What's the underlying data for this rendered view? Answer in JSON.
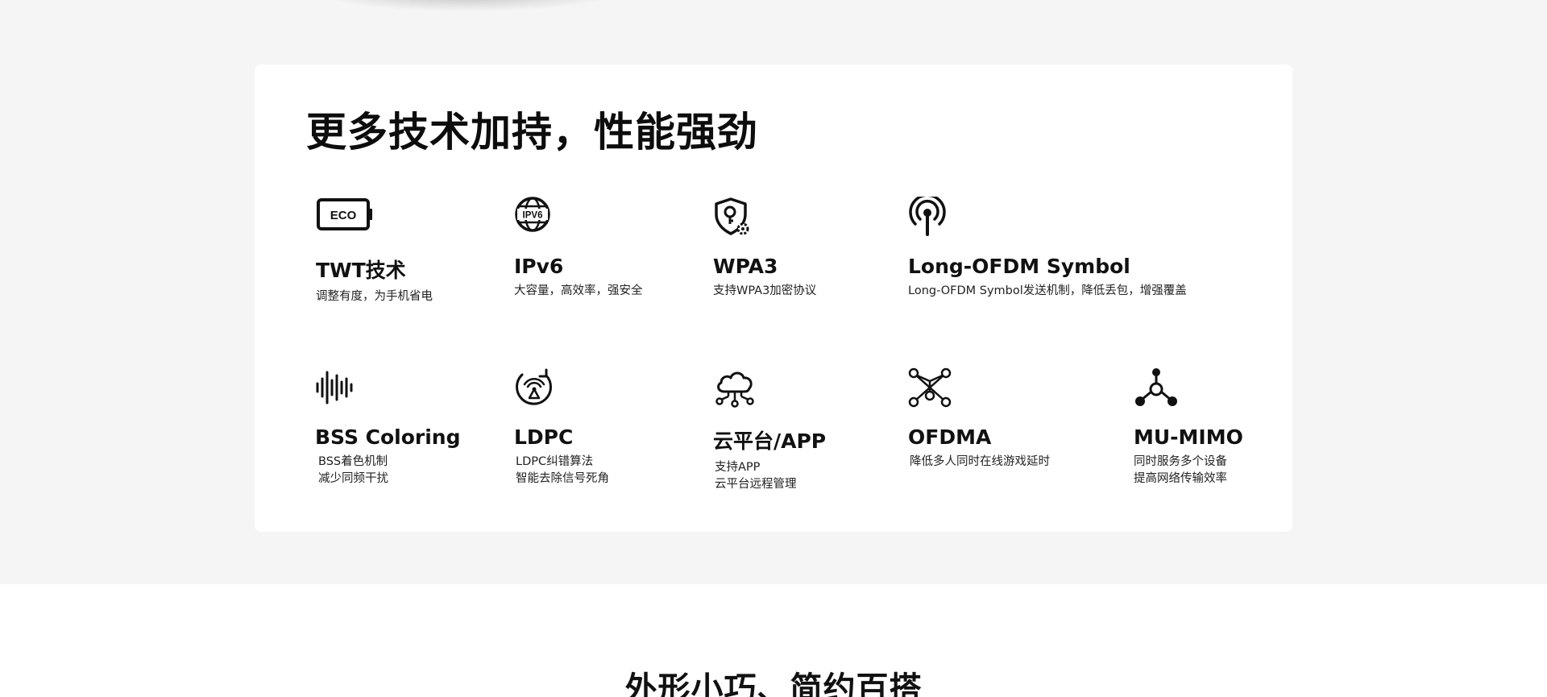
{
  "section": {
    "title": "更多技术加持，性能强劲"
  },
  "features": [
    {
      "name": "TWT技术",
      "desc": [
        "调整有度，为手机省电"
      ],
      "icon": "eco-battery-icon",
      "icon_text": "ECO"
    },
    {
      "name": "IPv6",
      "desc": [
        "大容量，高效率，强安全"
      ],
      "icon": "ipv6-globe-icon",
      "icon_text": "IPV6"
    },
    {
      "name": "WPA3",
      "desc": [
        "支持WPA3加密协议"
      ],
      "icon": "security-shield-icon"
    },
    {
      "name": "Long-OFDM Symbol",
      "desc": [
        "Long-OFDM Symbol发送机制，降低丢包，增强覆盖"
      ],
      "icon": "antenna-signal-icon"
    },
    {
      "name": "BSS Coloring",
      "desc": [
        "BSS着色机制",
        "减少同频干扰"
      ],
      "icon": "sound-wave-icon"
    },
    {
      "name": "LDPC",
      "desc": [
        "LDPC纠错算法",
        "智能去除信号死角"
      ],
      "icon": "signal-refresh-icon"
    },
    {
      "name": "云平台/APP",
      "desc": [
        "支持APP",
        "云平台远程管理"
      ],
      "icon": "cloud-network-icon"
    },
    {
      "name": "OFDMA",
      "desc": [
        "降低多人同时在线游戏延时"
      ],
      "icon": "multi-node-icon"
    },
    {
      "name": "MU-MIMO",
      "desc": [
        "同时服务多个设备",
        "提高网络传输效率"
      ],
      "icon": "hub-nodes-icon"
    }
  ],
  "next_section": {
    "title": "外形小巧、简约百搭"
  },
  "colors": {
    "page_bg": "#f5f5f5",
    "card_bg": "#ffffff",
    "text": "#111111"
  }
}
